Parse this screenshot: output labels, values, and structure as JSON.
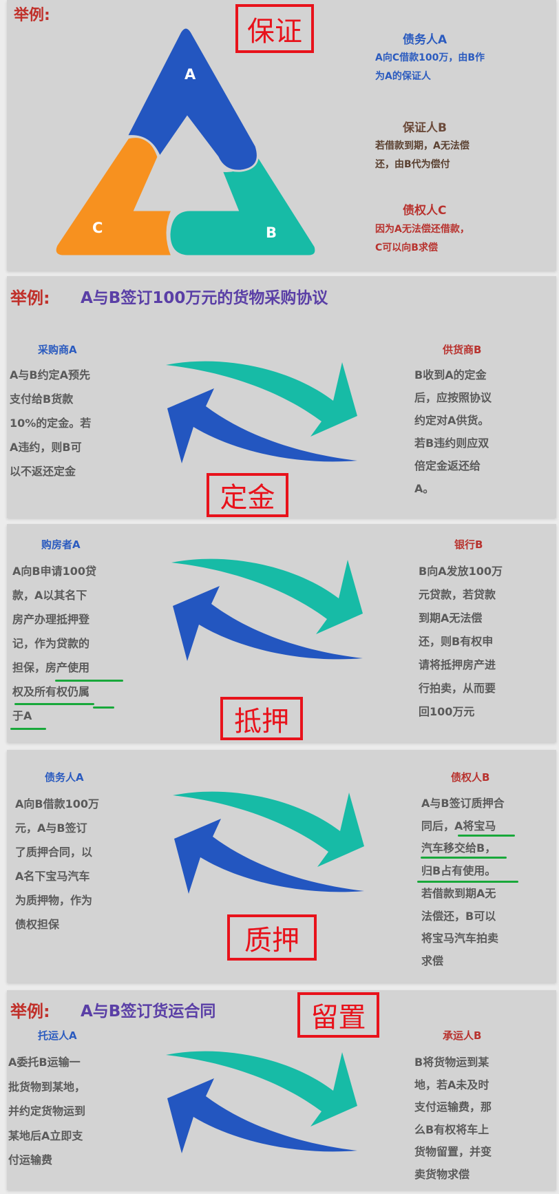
{
  "section1": {
    "example_label": "举例:",
    "tag": "保证",
    "triangle": {
      "a": "A",
      "b": "B",
      "c": "C"
    },
    "debtor": {
      "title": "债务人A",
      "lines": [
        "A向C借款100万，由B作",
        "为A的保证人"
      ]
    },
    "guarantor": {
      "title": "保证人B",
      "lines": [
        "若借款到期，A无法偿",
        "还，由B代为偿付"
      ]
    },
    "creditor": {
      "title": "债权人C",
      "lines": [
        "因为A无法偿还借款，",
        "C可以向B求偿"
      ]
    }
  },
  "section2": {
    "example_label": "举例:",
    "title": "A与B签订100万元的货物采购协议",
    "tag": "定金",
    "left": {
      "title": "采购商A",
      "lines": [
        "A与B约定A预先",
        "支付给B货款",
        "10%的定金。若",
        "A违约，则B可",
        "以不返还定金"
      ]
    },
    "right": {
      "title": "供货商B",
      "lines": [
        "B收到A的定金",
        "后，应按照协议",
        "约定对A供货。",
        "若B违约则应双",
        "倍定金返还给",
        "A。"
      ]
    }
  },
  "section3": {
    "tag": "抵押",
    "left": {
      "title": "购房者A",
      "lines": [
        "A向B申请100贷",
        "款，A以其名下",
        "房产办理抵押登",
        "记，作为贷款的",
        "担保，房产使用",
        "权及所有权仍属",
        "于A"
      ]
    },
    "right": {
      "title": "银行B",
      "lines": [
        "B向A发放100万",
        "元贷款，若贷款",
        "到期A无法偿",
        "还，则B有权申",
        "请将抵押房产进",
        "行拍卖，从而要",
        "回100万元"
      ]
    }
  },
  "section4": {
    "tag": "质押",
    "left": {
      "title": "债务人A",
      "lines": [
        "A向B借款100万",
        "元，A与B签订",
        "了质押合同，以",
        "A名下宝马汽车",
        "为质押物，作为",
        "债权担保"
      ]
    },
    "right": {
      "title": "债权人B",
      "lines": [
        "A与B签订质押合",
        "同后，A将宝马",
        "汽车移交给B，",
        "归B占有使用。",
        "若借款到期A无",
        "法偿还，B可以",
        "将宝马汽车拍卖",
        "求偿"
      ]
    }
  },
  "section5": {
    "example_label": "举例:",
    "title": "A与B签订货运合同",
    "tag": "留置",
    "left": {
      "title": "托运人A",
      "lines": [
        "A委托B运输一",
        "批货物到某地，",
        "并约定货物运到",
        "某地后A立即支",
        "付运输费"
      ]
    },
    "right": {
      "title": "承运人B",
      "lines": [
        "B将货物运到某",
        "地，若A未及时",
        "支付运输费，那",
        "么B有权将车上",
        "货物留置，并变",
        "卖货物求偿"
      ]
    }
  },
  "colors": {
    "blue": "#2356c0",
    "teal": "#17bba6",
    "orange": "#f7911f",
    "tag_red": "#e8121b",
    "underline_green": "#18a83a"
  }
}
